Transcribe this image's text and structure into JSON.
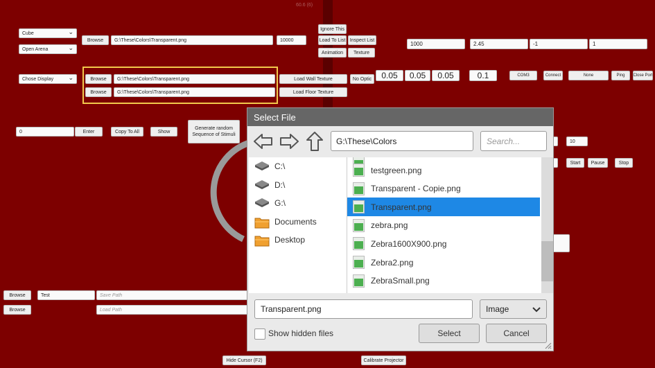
{
  "top_label": "60.6 (6)",
  "top_left": {
    "shape_select": "Cube",
    "arena_select": "Open Arena",
    "display_select": "Chose Display",
    "browse_label": "Browse",
    "texture_path": "G:\\These\\Colors\\Transparent.png",
    "number_field": "10000",
    "ignore_this": "Ignore This",
    "load_to_list": "Load To List",
    "inspect_list": "Inspect List",
    "animation": "Animation",
    "texture": "Texture"
  },
  "wall_floor": {
    "wall_browse": "Browse",
    "wall_path": "G:\\These\\Colors\\Transparent.png",
    "floor_browse": "Browse",
    "floor_path": "G:\\These\\Colors\\Transparent.png",
    "load_wall": "Load Wall Texture",
    "load_floor": "Load Floor Texture",
    "no_optic": "No Optic"
  },
  "params": {
    "speed": "1000",
    "rate": "2.45",
    "x_val": "-1",
    "y_val": "1",
    "scale_a": "0.05",
    "scale_b": "0.05",
    "scale_c": "0.05",
    "edge": "0.1",
    "com_port": "COM3",
    "connect": "Connect",
    "none": "None",
    "ping": "Ping",
    "close_port": "Close Port"
  },
  "row3": {
    "input_value": "0",
    "enter": "Enter",
    "copy_to_all": "Copy To All",
    "show": "Show",
    "generate": "Generate random Sequence of Stimuli",
    "count_value": "10",
    "start": "Start",
    "pause": "Pause",
    "stop": "Stop"
  },
  "bottom": {
    "browse1": "Browse",
    "test_value": "Test",
    "save_path_placeholder": "Save Path",
    "browse2": "Browse",
    "load_path_placeholder": "Load Path",
    "hide_cursor": "Hide Cursor (F2)",
    "calibrate": "Calibrate Projector"
  },
  "dialog": {
    "title": "Select File",
    "path": "G:\\These\\Colors",
    "search_placeholder": "Search...",
    "drives": [
      {
        "label": "C:\\",
        "icon": "drive-icon"
      },
      {
        "label": "D:\\",
        "icon": "drive-icon"
      },
      {
        "label": "G:\\",
        "icon": "drive-icon"
      },
      {
        "label": "Documents",
        "icon": "folder-icon"
      },
      {
        "label": "Desktop",
        "icon": "folder-icon"
      }
    ],
    "files": [
      {
        "label": "testgreen.png",
        "selected": false
      },
      {
        "label": "Transparent - Copie.png",
        "selected": false
      },
      {
        "label": "Transparent.png",
        "selected": true
      },
      {
        "label": "zebra.png",
        "selected": false
      },
      {
        "label": "Zebra1600X900.png",
        "selected": false
      },
      {
        "label": "Zebra2.png",
        "selected": false
      },
      {
        "label": "ZebraSmall.png",
        "selected": false
      }
    ],
    "filename": "Transparent.png",
    "filetype": "Image",
    "show_hidden": "Show hidden files",
    "select": "Select",
    "cancel": "Cancel",
    "accent_color": "#1e88e5"
  }
}
